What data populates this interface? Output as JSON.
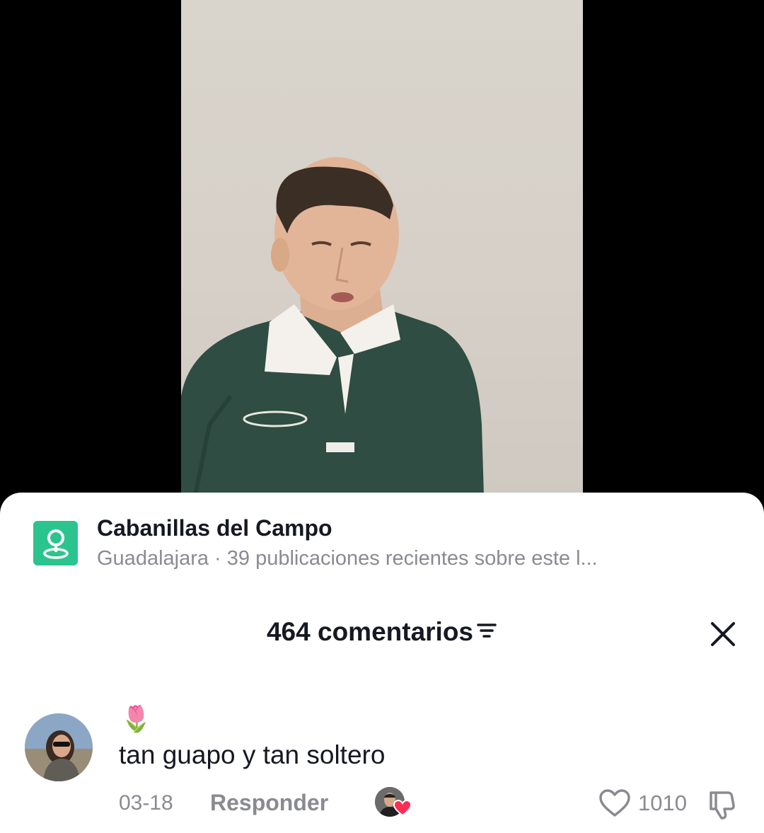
{
  "location": {
    "icon": "location-pin-icon",
    "title": "Cabanillas del Campo",
    "subtitle": "Guadalajara · 39 publicaciones recientes sobre este l..."
  },
  "comments_header": {
    "count_label": "464 comentarios",
    "sort_icon": "filter-lines-icon",
    "close_icon": "close-icon"
  },
  "comment": {
    "emoji": "🌷",
    "text": "tan guapo y tan soltero",
    "date": "03-18",
    "reply_label": "Responder",
    "likes": "1010"
  },
  "colors": {
    "location_icon_bg": "#2bc48e",
    "primary_text": "#161823",
    "secondary_text": "#8a8b91",
    "creator_heart": "#fe2c55"
  }
}
